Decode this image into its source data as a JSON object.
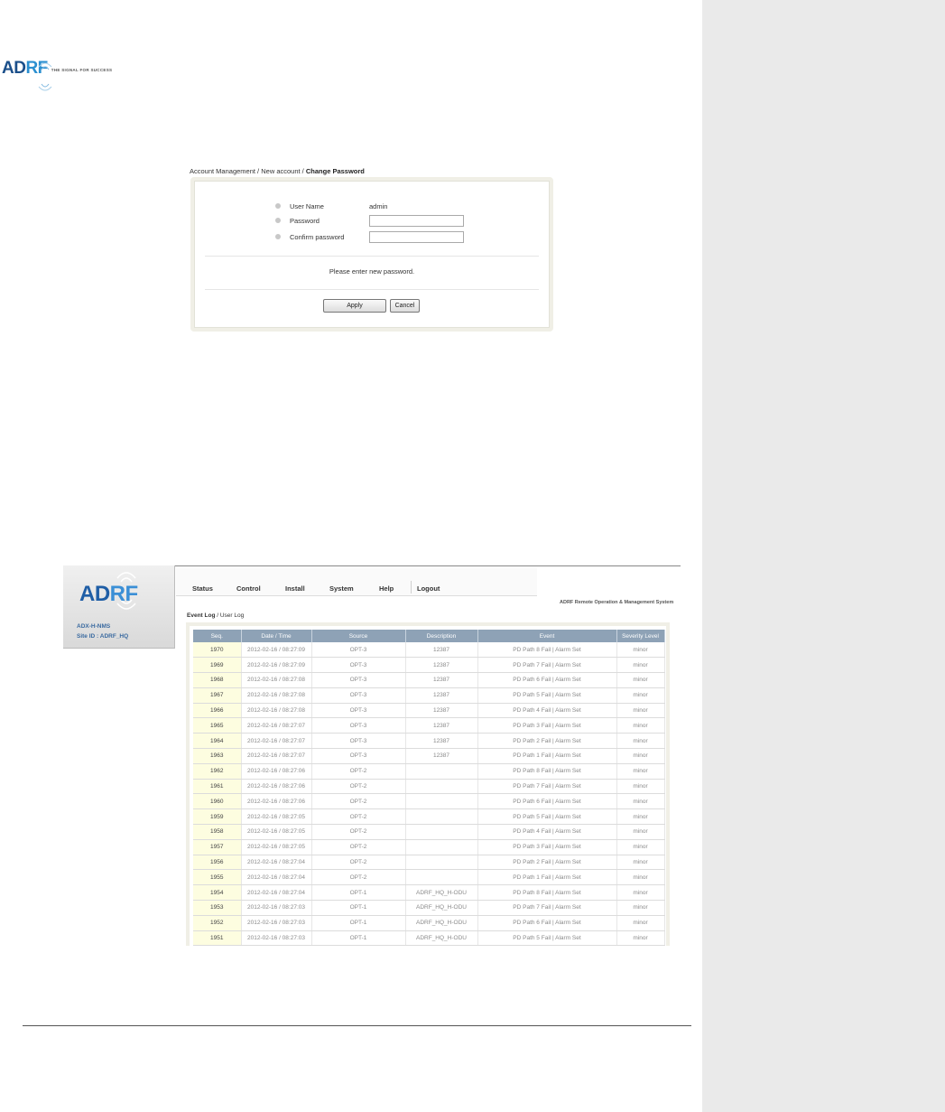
{
  "colors": {
    "brand_dark": "#1b4f8a",
    "brand_light": "#2a8fd0",
    "table_header": "#8ea2b6",
    "seq_cell": "#fdfde0",
    "side_band": "#eaeaea"
  },
  "doc_logo": {
    "brand_prefix": "AD",
    "brand_suffix": "RF",
    "tagline": "THE SIGNAL FOR SUCCESS"
  },
  "change_password": {
    "breadcrumb": {
      "part1": "Account Management",
      "sep1": " / ",
      "part2": "New account",
      "sep2": " / ",
      "current": "Change Password"
    },
    "fields": {
      "user_name": {
        "label": "User Name",
        "value": "admin"
      },
      "password": {
        "label": "Password",
        "value": ""
      },
      "confirm": {
        "label": "Confirm password",
        "value": ""
      }
    },
    "message": "Please enter new password.",
    "apply_label": "Apply",
    "cancel_label": "Cancel"
  },
  "event_log": {
    "brand_prefix": "AD",
    "brand_suffix": "RF",
    "model": "ADX-H-NMS",
    "site": "Site ID : ADRF_HQ",
    "nav": [
      "Status",
      "Control",
      "Install",
      "System",
      "Help",
      "Logout"
    ],
    "system_title": "ADRF Remote Operation & Management System",
    "breadcrumb": {
      "current": "Event Log",
      "sep": " / ",
      "other": "User Log"
    },
    "columns": [
      "Seq.",
      "Date / Time",
      "Source",
      "Description",
      "Event",
      "Severity Level"
    ],
    "rows": [
      [
        "1970",
        "2012-02-16 / 08:27:09",
        "OPT-3",
        "12387",
        "PD Path 8 Fail | Alarm Set",
        "minor"
      ],
      [
        "1969",
        "2012-02-16 / 08:27:09",
        "OPT-3",
        "12387",
        "PD Path 7 Fail | Alarm Set",
        "minor"
      ],
      [
        "1968",
        "2012-02-16 / 08:27:08",
        "OPT-3",
        "12387",
        "PD Path 6 Fail | Alarm Set",
        "minor"
      ],
      [
        "1967",
        "2012-02-16 / 08:27:08",
        "OPT-3",
        "12387",
        "PD Path 5 Fail | Alarm Set",
        "minor"
      ],
      [
        "1966",
        "2012-02-16 / 08:27:08",
        "OPT-3",
        "12387",
        "PD Path 4 Fail | Alarm Set",
        "minor"
      ],
      [
        "1965",
        "2012-02-16 / 08:27:07",
        "OPT-3",
        "12387",
        "PD Path 3 Fail | Alarm Set",
        "minor"
      ],
      [
        "1964",
        "2012-02-16 / 08:27:07",
        "OPT-3",
        "12387",
        "PD Path 2 Fail | Alarm Set",
        "minor"
      ],
      [
        "1963",
        "2012-02-16 / 08:27:07",
        "OPT-3",
        "12387",
        "PD Path 1 Fail | Alarm Set",
        "minor"
      ],
      [
        "1962",
        "2012-02-16 / 08:27:06",
        "OPT-2",
        "",
        "PD Path 8 Fail | Alarm Set",
        "minor"
      ],
      [
        "1961",
        "2012-02-16 / 08:27:06",
        "OPT-2",
        "",
        "PD Path 7 Fail | Alarm Set",
        "minor"
      ],
      [
        "1960",
        "2012-02-16 / 08:27:06",
        "OPT-2",
        "",
        "PD Path 6 Fail | Alarm Set",
        "minor"
      ],
      [
        "1959",
        "2012-02-16 / 08:27:05",
        "OPT-2",
        "",
        "PD Path 5 Fail | Alarm Set",
        "minor"
      ],
      [
        "1958",
        "2012-02-16 / 08:27:05",
        "OPT-2",
        "",
        "PD Path 4 Fail | Alarm Set",
        "minor"
      ],
      [
        "1957",
        "2012-02-16 / 08:27:05",
        "OPT-2",
        "",
        "PD Path 3 Fail | Alarm Set",
        "minor"
      ],
      [
        "1956",
        "2012-02-16 / 08:27:04",
        "OPT-2",
        "",
        "PD Path 2 Fail | Alarm Set",
        "minor"
      ],
      [
        "1955",
        "2012-02-16 / 08:27:04",
        "OPT-2",
        "",
        "PD Path 1 Fail | Alarm Set",
        "minor"
      ],
      [
        "1954",
        "2012-02-16 / 08:27:04",
        "OPT-1",
        "ADRF_HQ_H-ODU",
        "PD Path 8 Fail | Alarm Set",
        "minor"
      ],
      [
        "1953",
        "2012-02-16 / 08:27:03",
        "OPT-1",
        "ADRF_HQ_H-ODU",
        "PD Path 7 Fail | Alarm Set",
        "minor"
      ],
      [
        "1952",
        "2012-02-16 / 08:27:03",
        "OPT-1",
        "ADRF_HQ_H-ODU",
        "PD Path 6 Fail | Alarm Set",
        "minor"
      ],
      [
        "1951",
        "2012-02-16 / 08:27:03",
        "OPT-1",
        "ADRF_HQ_H-ODU",
        "PD Path 5 Fail | Alarm Set",
        "minor"
      ]
    ]
  }
}
